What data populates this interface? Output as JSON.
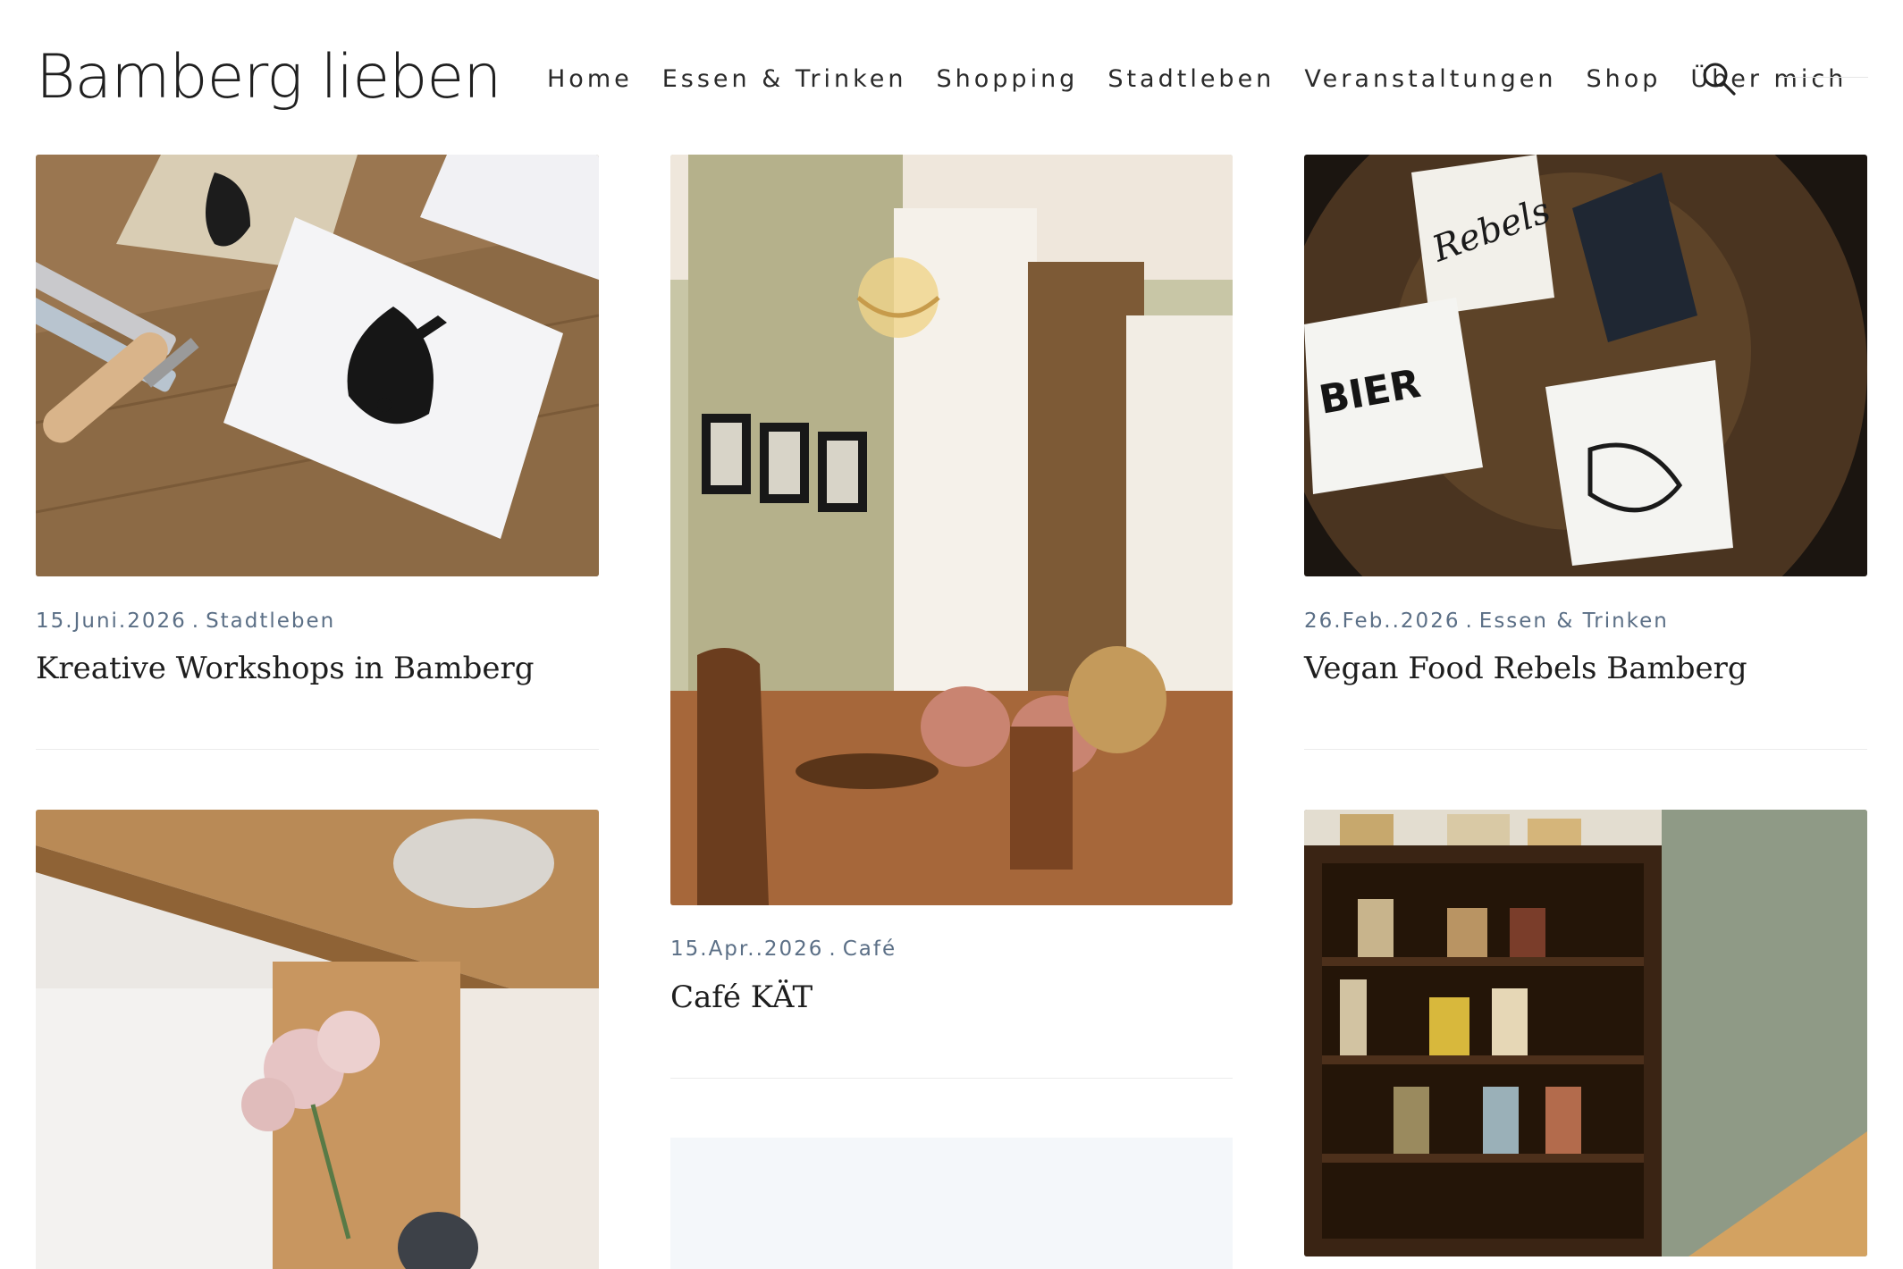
{
  "site": {
    "title": "Bamberg lieben"
  },
  "nav": {
    "items": [
      "Home",
      "Essen & Trinken",
      "Shopping",
      "Stadtleben",
      "Veranstaltungen",
      "Shop",
      "Über mich"
    ],
    "search_icon": "search-icon"
  },
  "posts": [
    {
      "date": "15.Juni.2026",
      "separator": ".",
      "category": "Stadtleben",
      "title": "Kreative Workshops in Bamberg",
      "image_icon": "linocut-prints-image"
    },
    {
      "date": "15.Apr..2026",
      "separator": ".",
      "category": "Café",
      "title": "Café KÄT",
      "image_icon": "cafe-interior-image"
    },
    {
      "date": "26.Feb..2026",
      "separator": ".",
      "category": "Essen & Trinken",
      "title": "Vegan Food Rebels Bamberg",
      "image_icon": "stickers-on-table-image"
    },
    {
      "image_icon": "shelf-with-flowers-image"
    },
    {
      "image_icon": "bookshop-shelves-image"
    }
  ]
}
